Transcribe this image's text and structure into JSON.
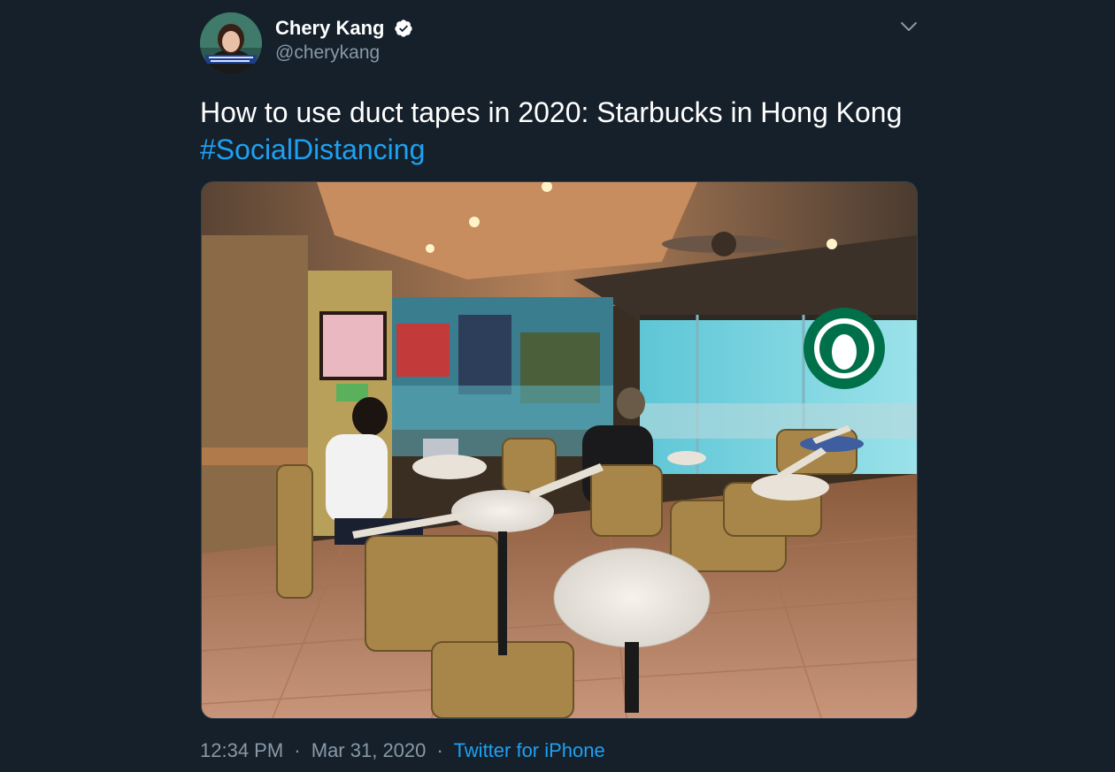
{
  "tweet": {
    "author": {
      "display_name": "Chery Kang",
      "handle": "@cherykang",
      "verified": true,
      "avatar_icon": "avatar-photo"
    },
    "text": "How to use duct tapes in 2020: Starbucks in Hong Kong",
    "hashtag": "#SocialDistancing",
    "media": {
      "kind": "photo",
      "icon": "cafe-photo"
    },
    "time": "12:34 PM",
    "date": "Mar 31, 2020",
    "separator": "·",
    "source": "Twitter for iPhone"
  },
  "colors": {
    "background": "#15202b",
    "text": "#ffffff",
    "secondary": "#8899a6",
    "accent": "#1da1f2",
    "border": "#38444d"
  }
}
